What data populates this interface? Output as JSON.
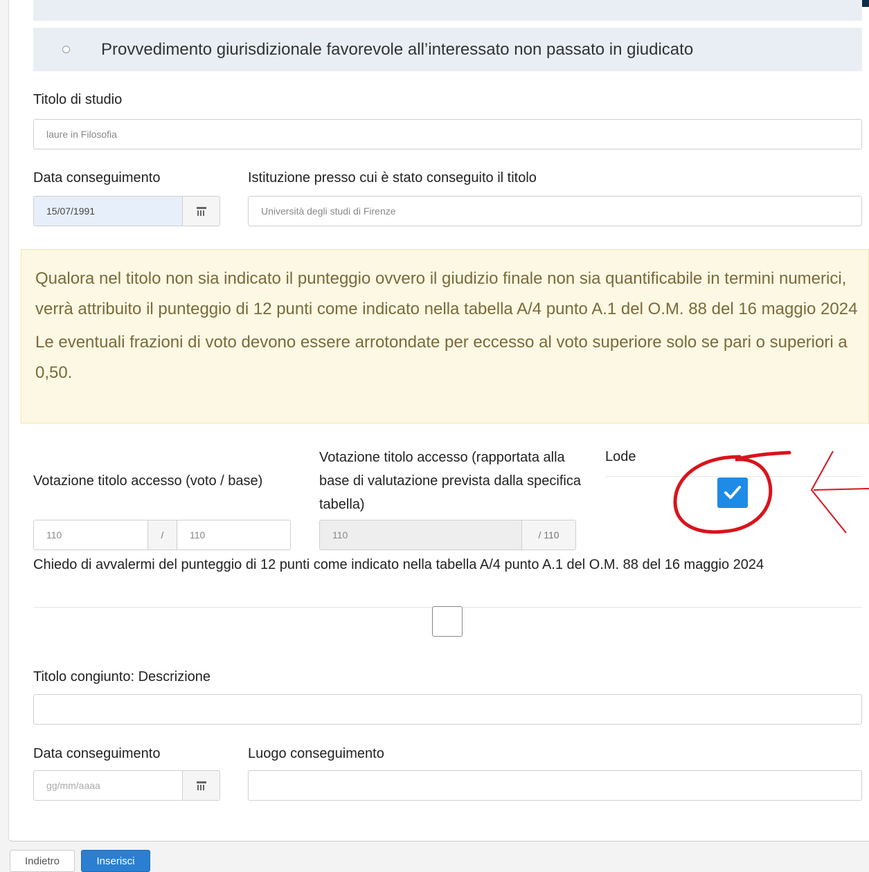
{
  "option": {
    "label": "Provvedimento giurisdizionale favorevole all’interessato non passato in giudicato"
  },
  "titolo_studio": {
    "label": "Titolo di studio",
    "value": "laure in Filosofia"
  },
  "data_conseguimento": {
    "label": "Data conseguimento",
    "value": "15/07/1991"
  },
  "istituzione": {
    "label": "Istituzione presso cui è stato conseguito il titolo",
    "value": "Università degli studi di Firenze"
  },
  "notice": {
    "p1": "Qualora nel titolo non sia indicato il punteggio ovvero il giudizio finale non sia quantificabile in termini numerici, verrà attribuito il punteggio di 12 punti come indicato nella tabella A/4 punto A.1 del O.M. 88 del 16 maggio 2024",
    "p2": "Le eventuali frazioni di voto devono essere arrotondate per eccesso al voto superiore solo se pari o superiori a 0,50."
  },
  "votazione": {
    "label": "Votazione titolo accesso (voto / base)",
    "voto": "110",
    "separator": "/",
    "base": "110"
  },
  "votazione_rapportata": {
    "label": "Votazione titolo accesso (rapportata alla base di valutazione prevista dalla specifica tabella)",
    "value": "110",
    "suffix": "/ 110"
  },
  "lode": {
    "label": "Lode",
    "checked": true
  },
  "punteggio12": {
    "label": "Chiedo di avvalermi del punteggio di 12 punti come indicato nella tabella A/4 punto A.1 del O.M. 88 del 16 maggio 2024",
    "checked": false
  },
  "titolo_congiunto": {
    "label": "Titolo congiunto: Descrizione",
    "value": ""
  },
  "data_conseguimento2": {
    "label": "Data conseguimento",
    "placeholder": "gg/mm/aaaa"
  },
  "luogo": {
    "label": "Luogo conseguimento",
    "value": ""
  },
  "buttons": {
    "back": "Indietro",
    "insert": "Inserisci"
  },
  "colors": {
    "primary": "#2a7fd0",
    "checkbox": "#1e8be6",
    "notice_bg": "#fcf8e3",
    "annotation": "#d8141c"
  }
}
